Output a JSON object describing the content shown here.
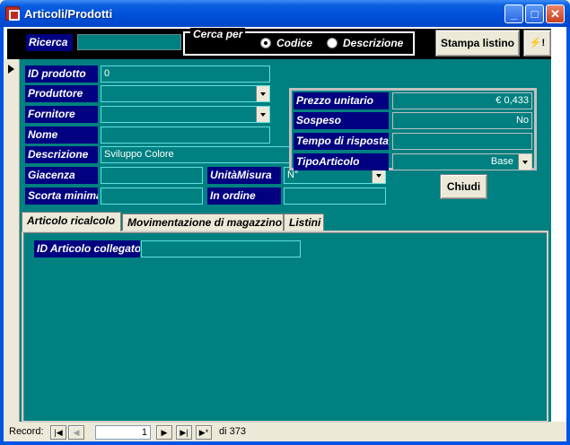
{
  "window": {
    "title": "Articoli/Prodotti",
    "buttons": {
      "minimize": "_",
      "maximize": "□",
      "close": "✕"
    }
  },
  "header": {
    "search_label": "Ricerca",
    "search_value": "",
    "search_by_label": "Cerca per",
    "option_code": "Codice",
    "option_description": "Descrizione",
    "selected_option": "Codice",
    "print_button": "Stampa listino",
    "tool_button": "⚡!"
  },
  "fields": {
    "id_prodotto": {
      "label": "ID prodotto",
      "value": "0"
    },
    "produttore": {
      "label": "Produttore",
      "value": ""
    },
    "fornitore": {
      "label": "Fornitore",
      "value": ""
    },
    "nome": {
      "label": "Nome",
      "value": ""
    },
    "descrizione": {
      "label": "Descrizione",
      "value": "Sviluppo Colore"
    },
    "giacenza": {
      "label": "Giacenza",
      "value": ""
    },
    "scorta_minima": {
      "label": "Scorta minima",
      "value": ""
    },
    "unita_misura": {
      "label": "UnitàMisura",
      "value": "N°"
    },
    "in_ordine": {
      "label": "In ordine",
      "value": ""
    },
    "prezzo_unitario": {
      "label": "Prezzo unitario",
      "value": "€ 0,433"
    },
    "sospeso": {
      "label": "Sospeso",
      "value": "No"
    },
    "tempo_risposta": {
      "label": "Tempo di risposta",
      "value": ""
    },
    "tipo_articolo": {
      "label": "TipoArticolo",
      "value": "Base"
    }
  },
  "close_button": "Chiudi",
  "tabs": [
    {
      "label": "Articolo ricalcolo",
      "active": true
    },
    {
      "label": "Movimentazione di magazzino",
      "active": false
    },
    {
      "label": "Listini",
      "active": false
    }
  ],
  "tab_page": {
    "id_articolo_collegato": {
      "label": "ID Articolo collegato",
      "value": ""
    }
  },
  "navigation": {
    "record_label": "Record:",
    "current": "1",
    "total_text": "di 373"
  },
  "colors": {
    "label_bg": "#000080",
    "form_bg": "#008080",
    "header_bg": "#000000"
  }
}
